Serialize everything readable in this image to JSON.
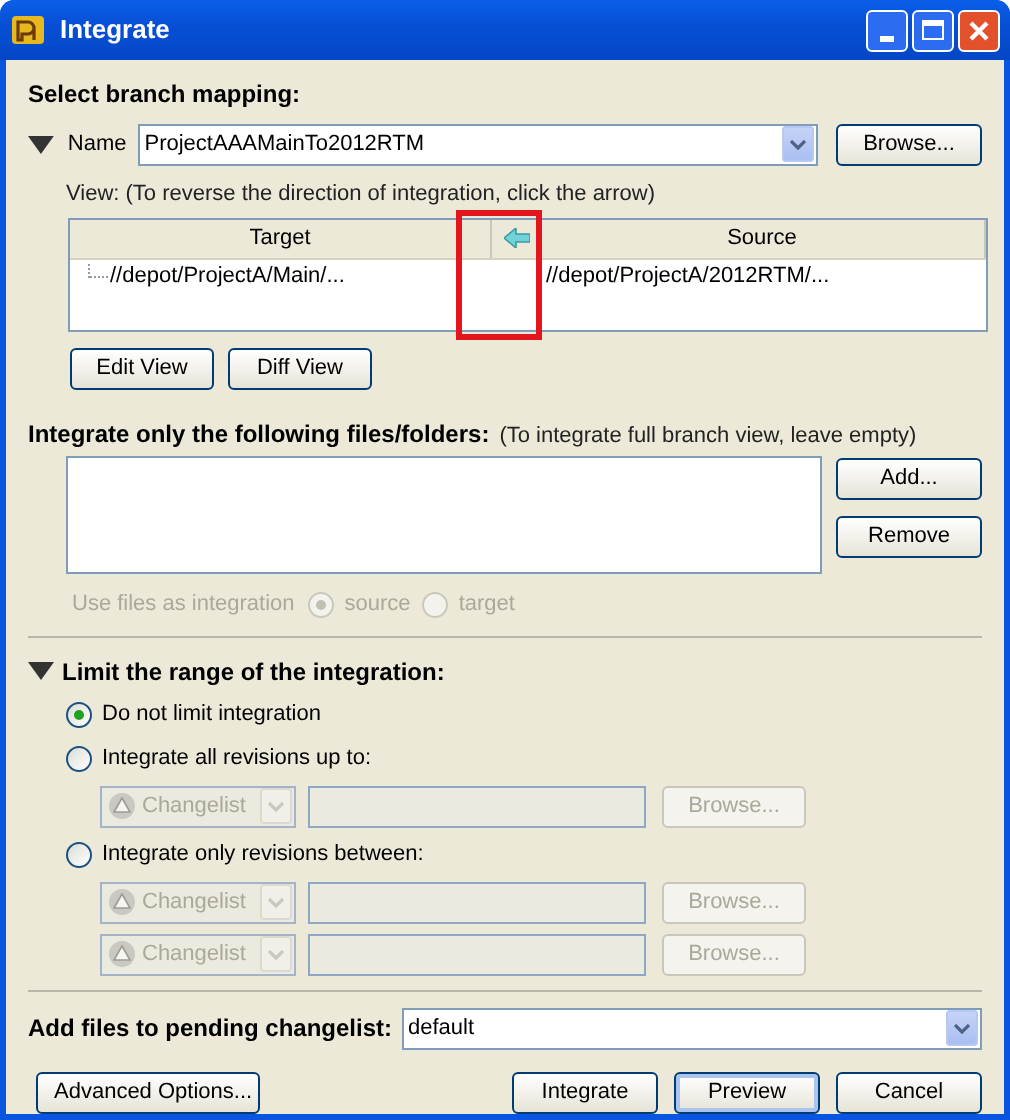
{
  "window": {
    "title": "Integrate"
  },
  "branch_mapping": {
    "heading": "Select branch mapping:",
    "expanded": true,
    "name_label": "Name",
    "name_value": "ProjectAAAMainTo2012RTM",
    "browse_button": "Browse...",
    "view_hint": "View: (To reverse the direction of integration, click the arrow)",
    "columns": [
      "Target",
      "Source"
    ],
    "rows": [
      {
        "target": "//depot/ProjectA/Main/...",
        "source": "//depot/ProjectA/2012RTM/..."
      }
    ],
    "buttons": [
      "Edit View",
      "Diff View"
    ]
  },
  "files": {
    "heading": "Integrate only the following files/folders:",
    "hint": "(To integrate full branch view, leave empty)",
    "buttons": [
      "Add...",
      "Remove"
    ],
    "use_as_label": "Use files as integration",
    "disabled": true,
    "use_as_options": [
      {
        "label": "source",
        "selected": true
      },
      {
        "label": "target",
        "selected": false
      }
    ]
  },
  "range": {
    "heading": "Limit the range of the integration:",
    "expanded": true,
    "options": [
      {
        "label": "Do not limit integration",
        "selected": true
      },
      {
        "label": "Integrate all revisions up to:",
        "selected": false,
        "pickers": [
          {
            "type": "Changelist",
            "browse": "Browse...",
            "disabled": true
          }
        ]
      },
      {
        "label": "Integrate only revisions between:",
        "selected": false,
        "pickers": [
          {
            "type": "Changelist",
            "browse": "Browse...",
            "disabled": true
          },
          {
            "type": "Changelist",
            "browse": "Browse...",
            "disabled": true
          }
        ]
      }
    ]
  },
  "pending": {
    "label": "Add files to pending changelist:",
    "value": "default"
  },
  "footer_buttons": [
    {
      "label": "Advanced Options...",
      "default": false
    },
    {
      "label": "Integrate",
      "default": false
    },
    {
      "label": "Preview",
      "default": true
    },
    {
      "label": "Cancel",
      "default": false
    }
  ]
}
